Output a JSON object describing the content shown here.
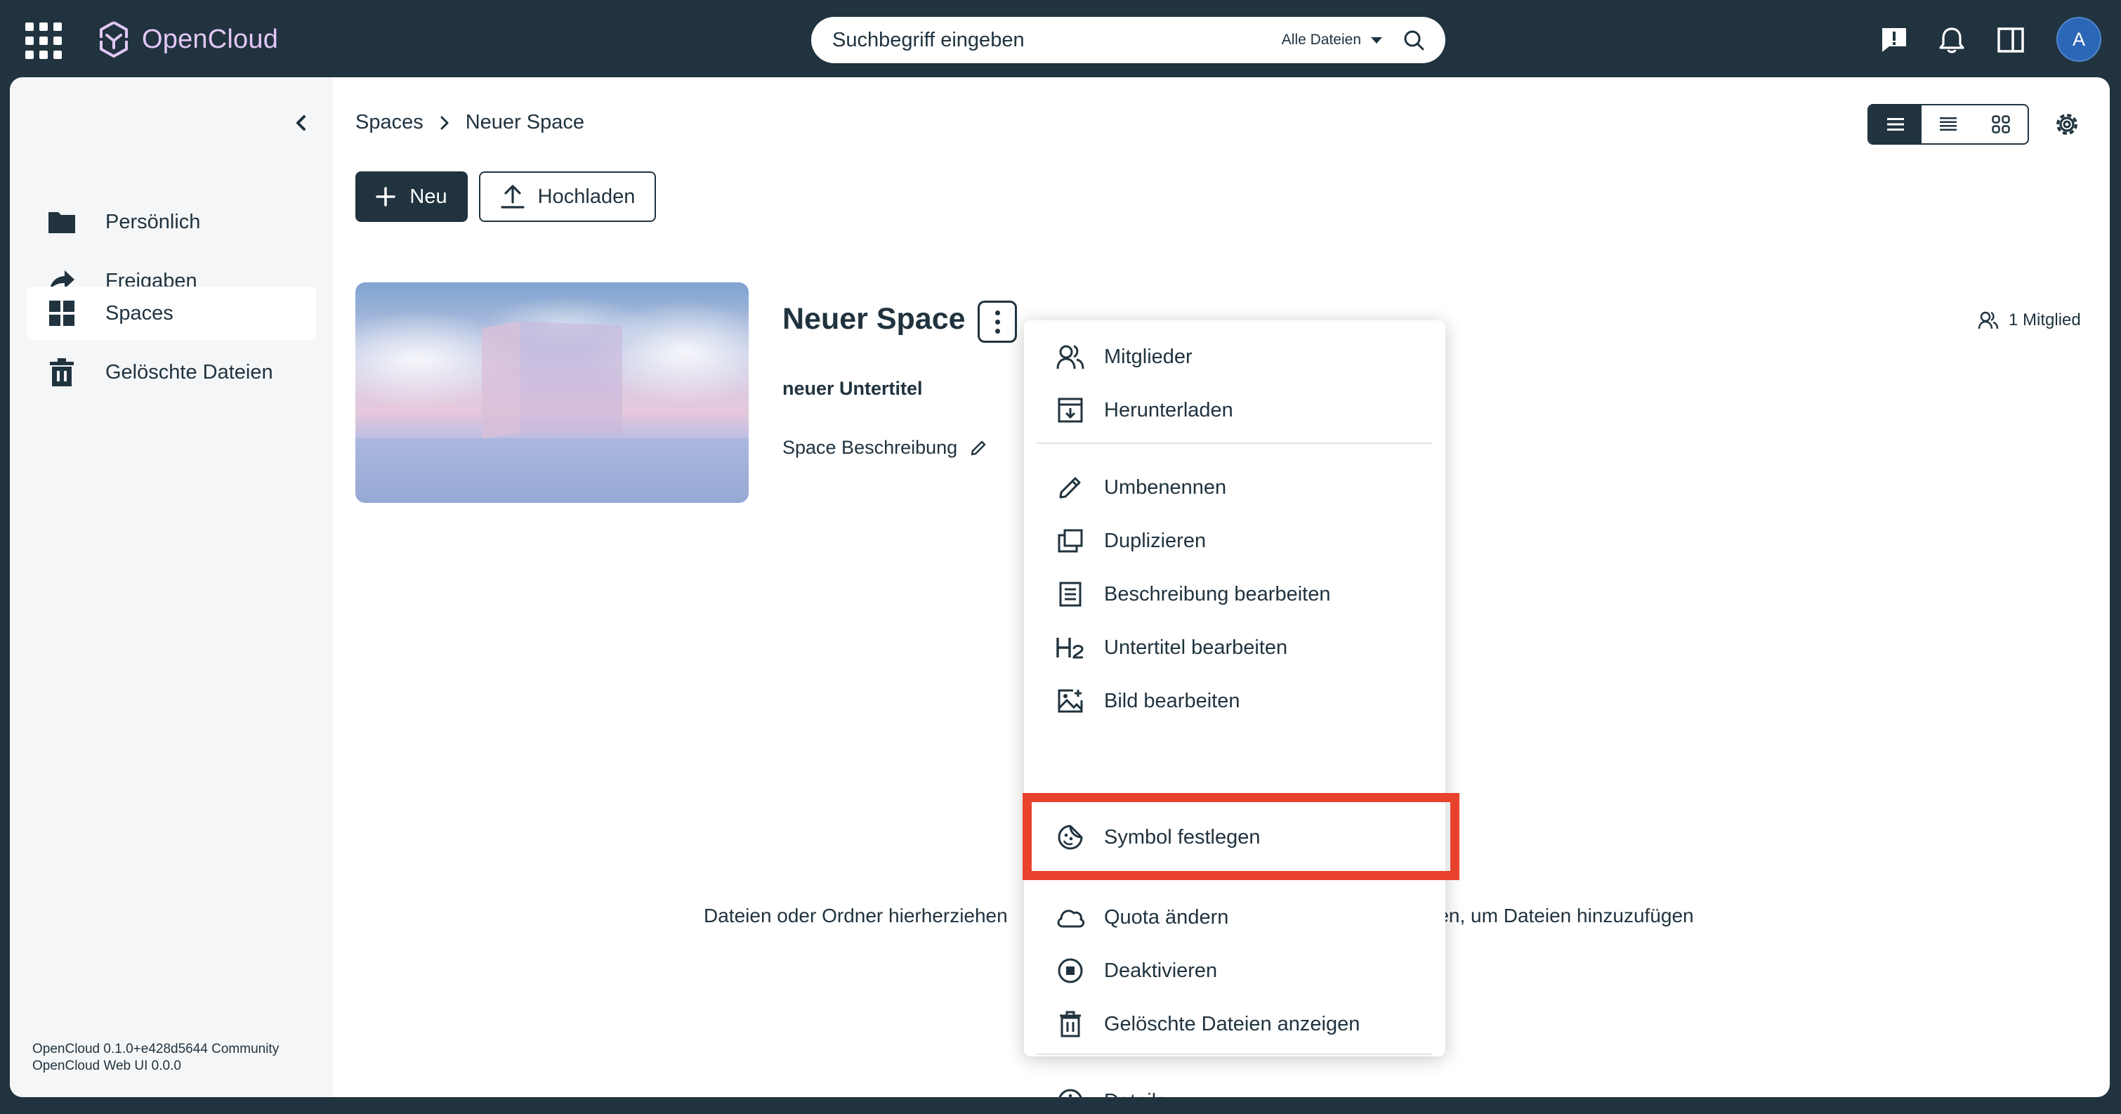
{
  "topbar": {
    "app_name": "OpenCloud",
    "search_placeholder": "Suchbegriff eingeben",
    "search_scope": "Alle Dateien",
    "avatar_initial": "A"
  },
  "sidebar": {
    "items": [
      {
        "label": "Persönlich",
        "icon": "folder-icon",
        "active": false
      },
      {
        "label": "Freigaben",
        "icon": "share-icon",
        "active": false
      },
      {
        "label": "Spaces",
        "icon": "spaces-grid-icon",
        "active": true
      },
      {
        "label": "Gelöschte Dateien",
        "icon": "trash-icon",
        "active": false
      }
    ],
    "version_line1": "OpenCloud 0.1.0+e428d5644 Community",
    "version_line2": "OpenCloud Web UI 0.0.0"
  },
  "breadcrumb": {
    "items": [
      "Spaces",
      "Neuer Space"
    ]
  },
  "toolbar": {
    "new_label": "Neu",
    "upload_label": "Hochladen"
  },
  "space": {
    "title": "Neuer Space",
    "subtitle": "neuer Untertitel",
    "description": "Space Beschreibung",
    "members": "1 Mitglied"
  },
  "dropzone": {
    "text_left": "Dateien oder Ordner hierherziehen",
    "text_right": "utzen, um Dateien hinzuzufügen"
  },
  "context_menu": {
    "items": [
      {
        "label": "Mitglieder",
        "icon": "members-icon"
      },
      {
        "label": "Herunterladen",
        "icon": "download-icon"
      },
      {
        "label": "Umbenennen",
        "icon": "pencil-icon"
      },
      {
        "label": "Duplizieren",
        "icon": "duplicate-icon"
      },
      {
        "label": "Beschreibung bearbeiten",
        "icon": "description-icon"
      },
      {
        "label": "Untertitel bearbeiten",
        "icon": "heading-h2-icon"
      },
      {
        "label": "Bild bearbeiten",
        "icon": "image-icon"
      },
      {
        "label": "Symbol festlegen",
        "icon": "emoji-icon",
        "highlighted": true
      },
      {
        "label": "Quota ändern",
        "icon": "cloud-icon"
      },
      {
        "label": "Deaktivieren",
        "icon": "stop-circle-icon"
      },
      {
        "label": "Gelöschte Dateien anzeigen",
        "icon": "trash-icon"
      },
      {
        "label": "Details",
        "icon": "info-icon"
      }
    ]
  },
  "colors": {
    "topbar_bg": "#20333f",
    "brand_text": "#e3c7f5",
    "highlight": "#e8422d"
  }
}
